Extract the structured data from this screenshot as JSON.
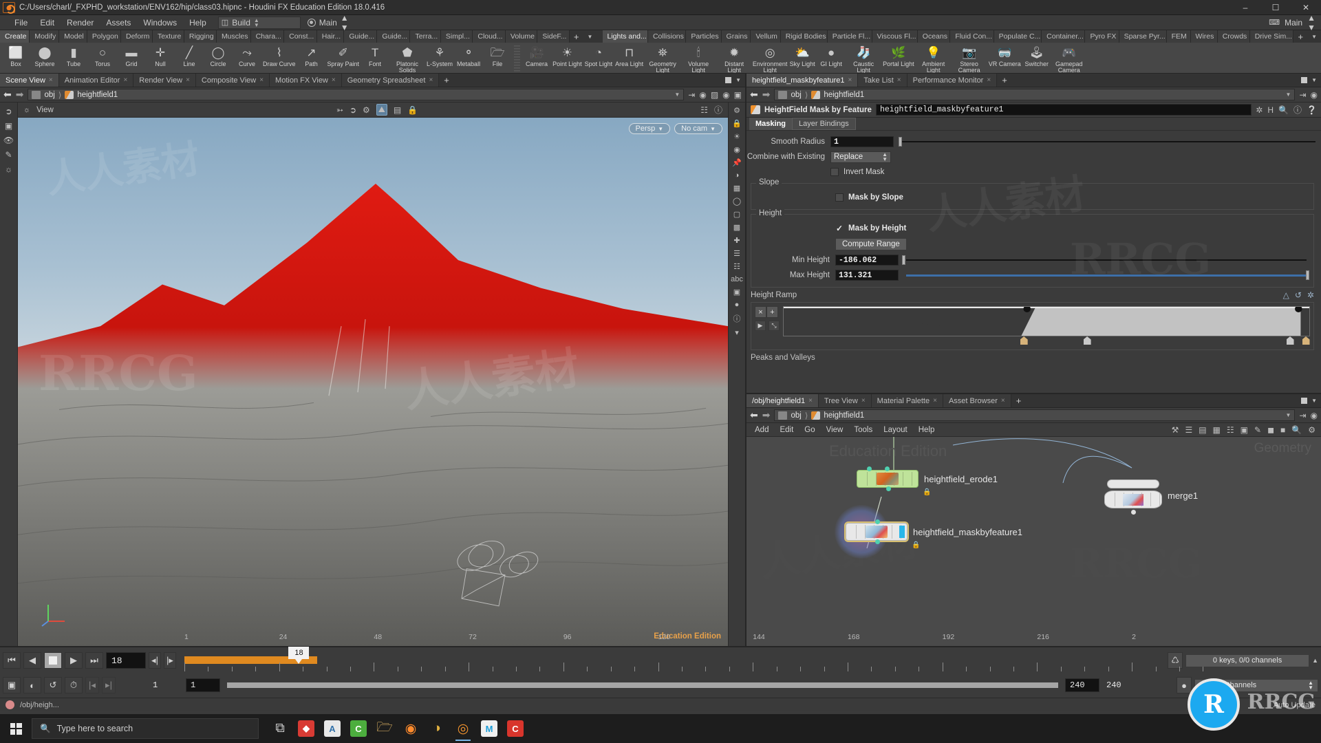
{
  "window": {
    "title": "C:/Users/charl/_FXPHD_workstation/ENV162/hip/class03.hipnc - Houdini FX Education Edition 18.0.416",
    "app_icon": "houdini-icon",
    "minimize": "–",
    "maximize": "☐",
    "close": "✕"
  },
  "menu": {
    "items": [
      "File",
      "Edit",
      "Render",
      "Assets",
      "Windows",
      "Help"
    ],
    "desktop": {
      "label": "Build",
      "icon": "layout-icon"
    },
    "target": {
      "label": "Main",
      "icon": "target-icon"
    },
    "right_label": "Main"
  },
  "shelf": {
    "tabs_left": [
      "Create",
      "Modify",
      "Model",
      "Polygon",
      "Deform",
      "Texture",
      "Rigging",
      "Muscles",
      "Chara...",
      "Const...",
      "Hair...",
      "Guide...",
      "Guide...",
      "Terra...",
      "Simpl...",
      "Cloud...",
      "Volume",
      "SideF..."
    ],
    "tabs_left_active": "Create",
    "tabs_right": [
      "Lights and...",
      "Collisions",
      "Particles",
      "Grains",
      "Vellum",
      "Rigid Bodies",
      "Particle Fl...",
      "Viscous Fl...",
      "Oceans",
      "Fluid Con...",
      "Populate C...",
      "Container...",
      "Pyro FX",
      "Sparse Pyr...",
      "FEM",
      "Wires",
      "Crowds",
      "Drive Sim..."
    ],
    "tabs_right_active": "Lights and...",
    "add_tab": "+",
    "tab_menu": "▼",
    "tools_left": [
      {
        "label": "Box",
        "icon": "box-icon",
        "glyph": "⬜"
      },
      {
        "label": "Sphere",
        "icon": "sphere-icon",
        "glyph": "⬤"
      },
      {
        "label": "Tube",
        "icon": "tube-icon",
        "glyph": "▮"
      },
      {
        "label": "Torus",
        "icon": "torus-icon",
        "glyph": "○"
      },
      {
        "label": "Grid",
        "icon": "grid-icon",
        "glyph": "▬"
      },
      {
        "label": "Null",
        "icon": "null-icon",
        "glyph": "✛"
      },
      {
        "label": "Line",
        "icon": "line-icon",
        "glyph": "╱"
      },
      {
        "label": "Circle",
        "icon": "circle-icon",
        "glyph": "◯"
      },
      {
        "label": "Curve",
        "icon": "curve-icon",
        "glyph": "⤳"
      },
      {
        "label": "Draw Curve",
        "icon": "draw-curve-icon",
        "glyph": "⌇"
      },
      {
        "label": "Path",
        "icon": "path-icon",
        "glyph": "↗"
      },
      {
        "label": "Spray Paint",
        "icon": "spray-paint-icon",
        "glyph": "✐"
      },
      {
        "label": "Font",
        "icon": "font-icon",
        "glyph": "T"
      },
      {
        "label": "Platonic Solids",
        "icon": "platonic-solids-icon",
        "glyph": "⬟"
      },
      {
        "label": "L-System",
        "icon": "l-system-icon",
        "glyph": "⚘"
      },
      {
        "label": "Metaball",
        "icon": "metaball-icon",
        "glyph": "⚬"
      },
      {
        "label": "File",
        "icon": "file-icon",
        "glyph": "🗁"
      }
    ],
    "tools_right": [
      {
        "label": "Camera",
        "icon": "camera-icon",
        "glyph": "🎥"
      },
      {
        "label": "Point Light",
        "icon": "point-light-icon",
        "glyph": "☀"
      },
      {
        "label": "Spot Light",
        "icon": "spot-light-icon",
        "glyph": "◔"
      },
      {
        "label": "Area Light",
        "icon": "area-light-icon",
        "glyph": "⊓"
      },
      {
        "label": "Geometry Light",
        "icon": "geometry-light-icon",
        "glyph": "⛯"
      },
      {
        "label": "Volume Light",
        "icon": "volume-light-icon",
        "glyph": "🕯"
      },
      {
        "label": "Distant Light",
        "icon": "distant-light-icon",
        "glyph": "✹"
      },
      {
        "label": "Environment Light",
        "icon": "environment-light-icon",
        "glyph": "◎"
      },
      {
        "label": "Sky Light",
        "icon": "sky-light-icon",
        "glyph": "⛅"
      },
      {
        "label": "GI Light",
        "icon": "gi-light-icon",
        "glyph": "●"
      },
      {
        "label": "Caustic Light",
        "icon": "caustic-light-icon",
        "glyph": "🧦"
      },
      {
        "label": "Portal Light",
        "icon": "portal-light-icon",
        "glyph": "🌿"
      },
      {
        "label": "Ambient Light",
        "icon": "ambient-light-icon",
        "glyph": "💡"
      },
      {
        "label": "Stereo Camera",
        "icon": "stereo-camera-icon",
        "glyph": "📷"
      },
      {
        "label": "VR Camera",
        "icon": "vr-camera-icon",
        "glyph": "🥽"
      },
      {
        "label": "Switcher",
        "icon": "switcher-icon",
        "glyph": "🕹"
      },
      {
        "label": "Gamepad Camera",
        "icon": "gamepad-camera-icon",
        "glyph": "🎮"
      }
    ]
  },
  "scene_pane": {
    "tabs": [
      "Scene View",
      "Animation Editor",
      "Render View",
      "Composite View",
      "Motion FX View",
      "Geometry Spreadsheet"
    ],
    "active_tab": "Scene View",
    "add_tab": "+",
    "path": {
      "root": "obj",
      "node": "heightfield1",
      "separator": "❯"
    },
    "viewport": {
      "view_label": "View",
      "projection": "Persp",
      "camera": "No cam",
      "watermark": "Education Edition"
    }
  },
  "params": {
    "pane_tabs": [
      "heightfield_maskbyfeature1",
      "Take List",
      "Performance Monitor"
    ],
    "pane_active_tab": "heightfield_maskbyfeature1",
    "add_tab": "+",
    "path": {
      "root": "obj",
      "node": "heightfield1"
    },
    "operator_type": "HeightField Mask by Feature",
    "operator_name": "heightfield_maskbyfeature1",
    "tabs": [
      "Masking",
      "Layer Bindings"
    ],
    "active_tab": "Masking",
    "smooth_radius": {
      "label": "Smooth Radius",
      "value": "1"
    },
    "combine_with_existing": {
      "label": "Combine with Existing",
      "value": "Replace"
    },
    "invert_mask": {
      "label": "Invert Mask",
      "checked": false
    },
    "slope_group": {
      "title": "Slope",
      "mask_by_slope": {
        "label": "Mask by Slope",
        "checked": false
      }
    },
    "height_group": {
      "title": "Height",
      "mask_by_height": {
        "label": "Mask by Height",
        "checked": true
      },
      "compute_range": "Compute Range",
      "min_height": {
        "label": "Min Height",
        "value": "-186.062"
      },
      "max_height": {
        "label": "Max Height",
        "value": "131.321"
      }
    },
    "height_ramp": {
      "label": "Height Ramp",
      "remove_key": "×",
      "add_key": "+",
      "play": "▶",
      "expand": "⤡"
    },
    "peaks_and_valleys": "Peaks and Valleys"
  },
  "network": {
    "tabs": [
      "/obj/heightfield1",
      "Tree View",
      "Material Palette",
      "Asset Browser"
    ],
    "active_tab": "/obj/heightfield1",
    "add_tab": "+",
    "path": {
      "root": "obj",
      "node": "heightfield1"
    },
    "menu": [
      "Add",
      "Edit",
      "Go",
      "View",
      "Tools",
      "Layout",
      "Help"
    ],
    "watermark_left": "Education Edition",
    "watermark_right": "Geometry",
    "nodes": [
      {
        "name": "heightfield_erode1",
        "type": "heightfield-erode",
        "selected": false
      },
      {
        "name": "heightfield_maskbyfeature1",
        "type": "heightfield-maskbyfeature",
        "selected": true
      },
      {
        "name": "merge1",
        "type": "merge",
        "selected": false
      }
    ]
  },
  "timeline": {
    "current_frame": "18",
    "playhead_label": "18",
    "range_start": "1",
    "range_start_2": "1",
    "range_end": "240",
    "range_end_2": "240",
    "ticks": [
      "1",
      "24",
      "48",
      "72",
      "96",
      "120",
      "144",
      "168",
      "192",
      "216",
      "2"
    ],
    "keys_status": "0 keys, 0/0 channels",
    "key_mode": "Key All Channels",
    "auto_update": "Auto Update",
    "status_path": "/obj/heigh..."
  },
  "taskbar": {
    "search_placeholder": "Type here to search",
    "search_icon": "search-icon",
    "start_icon": "windows-start-icon",
    "apps": [
      {
        "name": "task-view-icon",
        "glyph": "⧉",
        "color": "#cfcfcf",
        "bg": "transparent"
      },
      {
        "name": "app-red-diamond",
        "glyph": "◆",
        "color": "#ffffff",
        "bg": "#d83b34"
      },
      {
        "name": "app-document",
        "glyph": "A",
        "color": "#2f6fa8",
        "bg": "#e8e8e8"
      },
      {
        "name": "app-green-c",
        "glyph": "C",
        "color": "#ffffff",
        "bg": "#4cae3e"
      },
      {
        "name": "app-explorer",
        "glyph": "🗁",
        "color": "#f2c46a",
        "bg": "transparent"
      },
      {
        "name": "app-firefox",
        "glyph": "◉",
        "color": "#ff8b2d",
        "bg": "transparent"
      },
      {
        "name": "app-nuke",
        "glyph": "◑",
        "color": "#e0b040",
        "bg": "transparent"
      },
      {
        "name": "app-houdini",
        "glyph": "◎",
        "color": "#f0922e",
        "bg": "transparent"
      },
      {
        "name": "app-m",
        "glyph": "M",
        "color": "#1e9ed8",
        "bg": "#f0f0f0"
      },
      {
        "name": "app-red-c",
        "glyph": "C",
        "color": "#ffffff",
        "bg": "#d8352c"
      }
    ]
  },
  "colors": {
    "accent_orange": "#e08a20",
    "houdini_orange": "#f0922e",
    "selection_yellow": "#d8c070",
    "slider_blue": "#3d6fa8",
    "node_green": "#bfe39a",
    "edu_badge": "#e8a14a"
  },
  "watermarks": {
    "cn": "人人素材",
    "latin": "RRCG"
  }
}
